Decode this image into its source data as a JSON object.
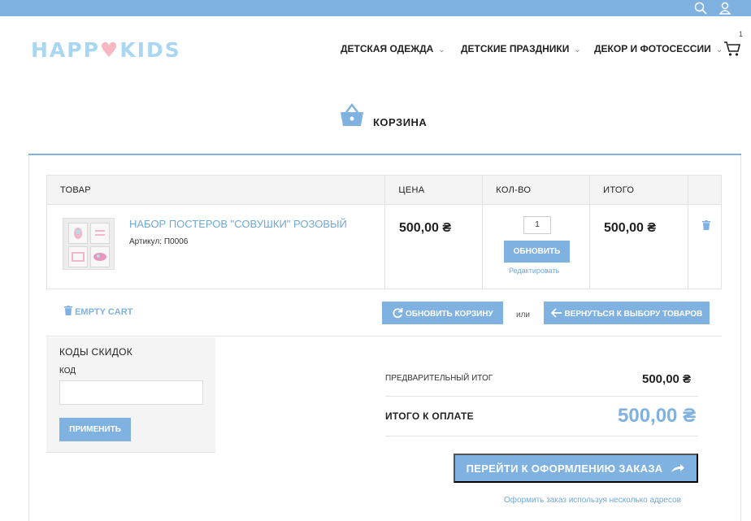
{
  "header": {
    "logo_left": "HAPP",
    "logo_heart": "♥",
    "logo_right": "KIDS",
    "nav": [
      {
        "label": "ДЕТСКАЯ ОДЕЖДА"
      },
      {
        "label": "ДЕТСКИЕ ПРАЗДНИКИ"
      },
      {
        "label": "ДЕКОР И ФОТОСЕССИИ"
      }
    ],
    "cart_count": "1"
  },
  "page": {
    "title": "КОРЗИНА"
  },
  "table": {
    "headers": [
      "ТОВАР",
      "ЦЕНА",
      "КОЛ-ВО",
      "ИТОГО"
    ],
    "item": {
      "name": "НАБОР ПОСТЕРОВ \"СОВУШКИ\" РОЗОВЫЙ",
      "sku": "Артикул: П0006",
      "price": "500,00 ₴",
      "qty": "1",
      "update_label": "ОБНОВИТЬ",
      "edit_label": "Редактировать",
      "total": "500,00 ₴"
    }
  },
  "actions": {
    "empty_cart": "EMPTY CART",
    "update_cart": "ОБНОВИТЬ КОРЗИНУ",
    "or": "или",
    "continue": "ВЕРНУТЬСЯ К ВЫБОРУ ТОВАРОВ"
  },
  "coupon": {
    "heading": "КОДЫ СКИДОК",
    "label": "КОД",
    "value": "",
    "apply": "ПРИМЕНИТЬ"
  },
  "totals": {
    "subtotal_label": "ПРЕДВАРИТЕЛЬНЫЙ ИТОГ",
    "subtotal_value": "500,00 ₴",
    "grand_label": "ИТОГО К ОПЛАТЕ",
    "grand_value": "500,00 ₴"
  },
  "checkout": {
    "button": "ПЕРЕЙТИ К ОФОРМЛЕНИЮ ЗАКАЗА",
    "multi_address": "Оформить заказ используя несколько адресов"
  },
  "colors": {
    "accent": "#7fb2e0",
    "logo_blue": "#a9d6f1",
    "logo_pink": "#f6b7c0"
  },
  "icons": [
    "search-icon",
    "user-icon",
    "cart-icon",
    "basket-icon",
    "trash-icon",
    "refresh-icon",
    "arrow-left-icon",
    "arrow-right-icon"
  ]
}
